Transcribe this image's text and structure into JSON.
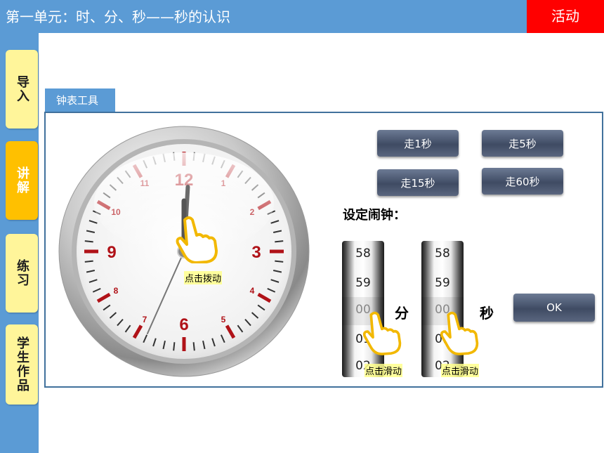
{
  "header": {
    "title": "第一单元：时、分、秒——秒的认识",
    "activity_label": "活动"
  },
  "sidebar": {
    "items": [
      {
        "label": "导入",
        "active": false
      },
      {
        "label": "讲解",
        "active": true
      },
      {
        "label": "练习",
        "active": false
      },
      {
        "label": "学生作品",
        "active": false
      }
    ]
  },
  "tool": {
    "tab_label": "钟表工具",
    "buttons": {
      "step1": "走1秒",
      "step5": "走5秒",
      "step15": "走15秒",
      "step60": "走60秒"
    },
    "alarm_label": "设定闹钟：",
    "minute_roller": {
      "numbers": [
        "58",
        "59",
        "00",
        "01",
        "02"
      ],
      "selected": "00",
      "unit": "分",
      "hint": "点击滑动"
    },
    "second_roller": {
      "numbers": [
        "58",
        "59",
        "00",
        "01",
        "02"
      ],
      "selected": "00",
      "unit": "秒",
      "hint": "点击滑动"
    },
    "ok_label": "OK",
    "clock": {
      "numbers": [
        "12",
        "1",
        "2",
        "3",
        "4",
        "5",
        "6",
        "7",
        "8",
        "9",
        "10",
        "11"
      ],
      "hint": "点击拨动",
      "hour": 12,
      "minute": 0,
      "second": 34,
      "accent_color": "#b01218"
    }
  }
}
